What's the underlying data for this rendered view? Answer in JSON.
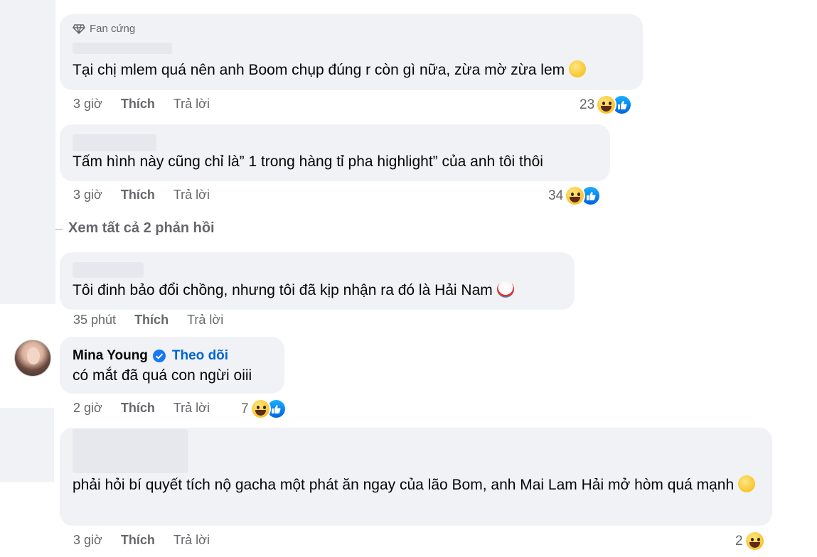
{
  "comments": [
    {
      "badge": "Fan cứng",
      "text": "Tại chị mlem quá nên anh Boom chụp đúng r còn gì nữa, zừa mờ zừa lem",
      "time": "3 giờ",
      "like_label": "Thích",
      "reply_label": "Trả lời",
      "reaction_count": "23",
      "text_emoji": "pleading-face-icon",
      "reactions": [
        "haha-icon",
        "like-icon"
      ]
    },
    {
      "text": "Tấm hình này cũng chỉ là” 1 trong hàng tỉ pha highlight” của anh tôi thôi",
      "time": "3 giờ",
      "like_label": "Thích",
      "reply_label": "Trả lời",
      "reaction_count": "34",
      "reactions": [
        "haha-icon",
        "like-icon"
      ]
    },
    {
      "text": "Tôi đinh bảo đổi chồng, nhưng tôi đã kịp nhận ra đó là Hải Nam",
      "time": "35 phút",
      "like_label": "Thích",
      "reply_label": "Trả lời",
      "text_emoji": "clown-face-icon"
    },
    {
      "username": "Mina Young",
      "follow_label": "Theo dõi",
      "text": "có mắt đã quá con ngừi oiii",
      "time": "2 giờ",
      "like_label": "Thích",
      "reply_label": "Trả lời",
      "reaction_count": "7",
      "reactions": [
        "haha-icon",
        "like-icon"
      ]
    },
    {
      "text": "phải hỏi bí quyết tích nộ gacha một phát ăn ngay của lão Bom, anh Mai Lam Hải mở hòm quá mạnh",
      "time": "3 giờ",
      "like_label": "Thích",
      "reply_label": "Trả lời",
      "reaction_count": "2",
      "text_emoji": "steam-face-icon",
      "reactions": [
        "haha-icon"
      ]
    }
  ],
  "view_replies_label": "Xem tất cả 2 phản hồi",
  "colors": {
    "bubble": "#f0f2f5",
    "meta_text": "#65676b",
    "link_blue": "#0064d1",
    "like_blue": "#1877f2"
  }
}
